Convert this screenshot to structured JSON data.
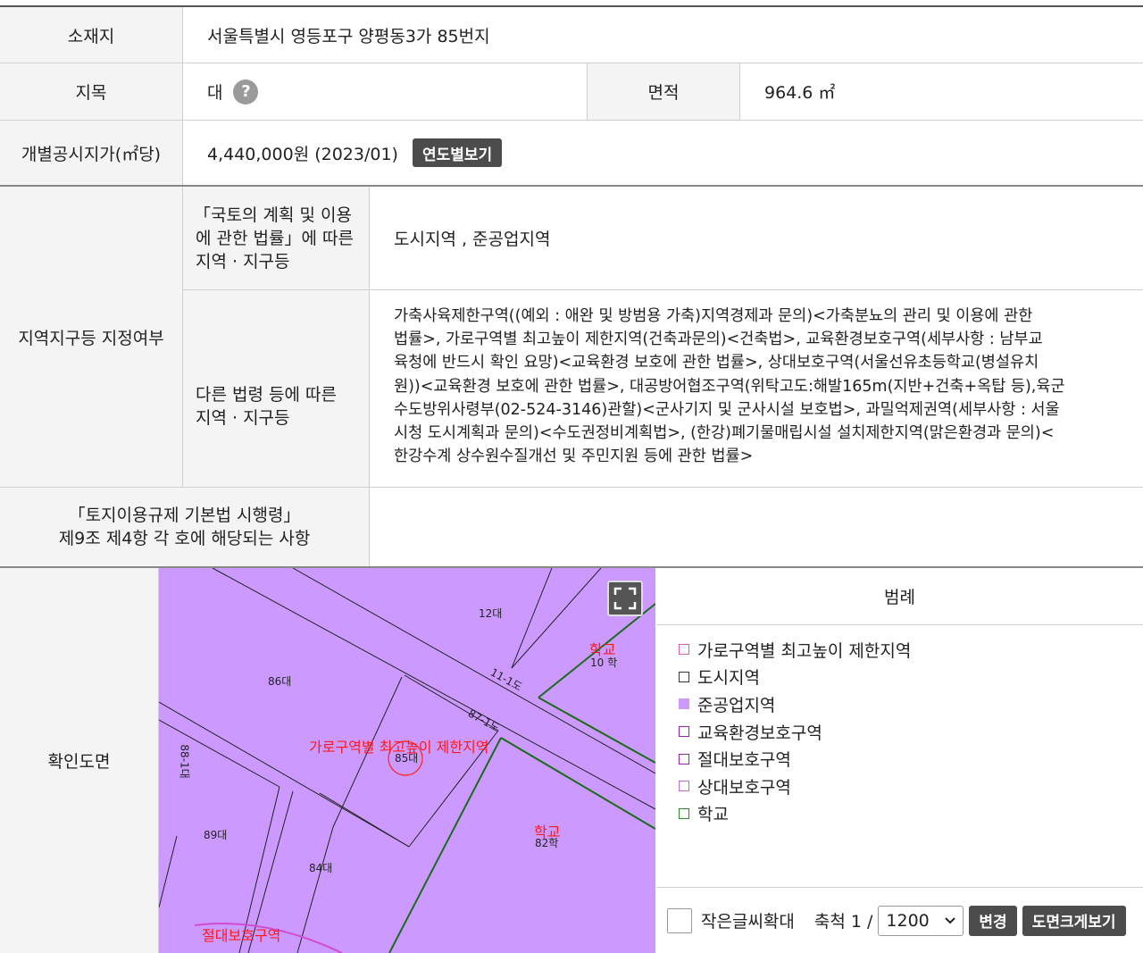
{
  "rows": {
    "location": {
      "label": "소재지",
      "value": "서울특별시 영등포구 양평동3가 85번지"
    },
    "land_category": {
      "label": "지목",
      "value": "대",
      "help_icon": "?"
    },
    "area": {
      "label": "면적",
      "value": "964.6 ㎡"
    },
    "price": {
      "label": "개별공시지가(㎡당)",
      "value": "4,440,000원 (2023/01)",
      "button": "연도별보기"
    }
  },
  "zones": {
    "label": "지역지구등 지정여부",
    "national": {
      "label_lines": [
        "「국토의 계획 및 이용",
        "에 관한 법률」에 따른",
        "지역 · 지구등"
      ],
      "value": "도시지역 , 준공업지역"
    },
    "other": {
      "label_lines": [
        "다른 법령 등에 따른",
        "지역 · 지구등"
      ],
      "value_lines": [
        "가축사육제한구역((예외 : 애완 및 방범용 가축)지역경제과 문의)<가축분뇨의 관리 및 이용에 관한",
        "법률>, 가로구역별 최고높이 제한지역(건축과문의)<건축법>, 교육환경보호구역(세부사항 : 남부교",
        "육청에 반드시 확인 요망)<교육환경 보호에 관한 법률>, 상대보호구역(서울선유초등학교(병설유치",
        "원))<교육환경 보호에 관한 법률>, 대공방어협조구역(위탁고도:해발165m(지반+건축+옥탑 등),육군",
        "수도방위사령부(02-524-3146)관할)<군사기지 및 군사시설 보호법>, 과밀억제권역(세부사항 : 서울",
        "시청 도시계획과 문의)<수도권정비계획법>, (한강)폐기물매립시설 설치제한지역(맑은환경과 문의)<",
        "한강수계 상수원수질개선 및 주민지원 등에 관한 법률>"
      ]
    }
  },
  "regulation": {
    "label_lines": [
      "「토지이용규제 기본법 시행령」",
      "제9조 제4항 각 호에 해당되는 사항"
    ],
    "value": ""
  },
  "map_section": {
    "label": "확인도면",
    "expand_icon": "expand-icon",
    "map_labels": {
      "l12": "12대",
      "l11": "11-1도",
      "l86": "86대",
      "l87": "87-1도",
      "l88": "88-1대",
      "l89": "89대",
      "l84": "84대",
      "l85": "85대",
      "l10": "10 학",
      "l82": "82학",
      "school1": "학교",
      "school2": "학교",
      "height": "가로구역별 최고높이 제한지역",
      "absolute": "절대보호구역"
    },
    "legend_title": "범례",
    "legend": [
      {
        "label": "가로구역별 최고높이 제한지역",
        "color": "#e05aa8",
        "fill": "#ffffff"
      },
      {
        "label": "도시지역",
        "color": "#333333",
        "fill": "#ffffff"
      },
      {
        "label": "준공업지역",
        "color": "#cc99ff",
        "fill": "#cc99ff"
      },
      {
        "label": "교육환경보호구역",
        "color": "#9b1fb3",
        "fill": "#ffffff"
      },
      {
        "label": "절대보호구역",
        "color": "#a020b0",
        "fill": "#ffffff"
      },
      {
        "label": "상대보호구역",
        "color": "#cc66cc",
        "fill": "#ffffff"
      },
      {
        "label": "학교",
        "color": "#2a8a2a",
        "fill": "#ffffff"
      }
    ],
    "controls": {
      "small_text_label": "작은글씨확대",
      "scale_label": "축척 1 /",
      "scale_value": "1200",
      "change_button": "변경",
      "enlarge_button": "도면크게보기"
    }
  }
}
